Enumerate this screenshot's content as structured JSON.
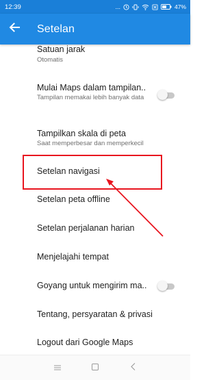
{
  "status_bar": {
    "time": "12:39",
    "dots": "...",
    "battery": "47%"
  },
  "app_bar": {
    "title": "Setelan",
    "back_icon": "arrow-back-icon"
  },
  "settings": [
    {
      "title": "Satuan jarak",
      "subtitle": "Otomatis"
    },
    {
      "title": "Mulai Maps dalam tampilan..",
      "subtitle": "Tampilan memakai lebih banyak data",
      "toggle": false
    },
    {
      "title": "Tampilkan skala di peta",
      "subtitle": "Saat memperbesar dan memperkecil"
    },
    {
      "title": "Setelan navigasi",
      "highlighted": true
    },
    {
      "title": "Setelan peta offline"
    },
    {
      "title": "Setelan perjalanan harian"
    },
    {
      "title": "Menjelajahi tempat"
    },
    {
      "title": "Goyang untuk mengirim ma..",
      "toggle": false
    },
    {
      "title": "Tentang, persyaratan & privasi"
    },
    {
      "title": "Logout dari Google Maps"
    }
  ],
  "annotation": {
    "highlight_color": "#e8141e",
    "target": "Setelan navigasi"
  },
  "nav_bar": {
    "icons": [
      "menu-icon",
      "square-icon",
      "chevron-left-icon"
    ]
  },
  "colors": {
    "status_bar": "#1a7fd8",
    "app_bar": "#2089e3"
  }
}
